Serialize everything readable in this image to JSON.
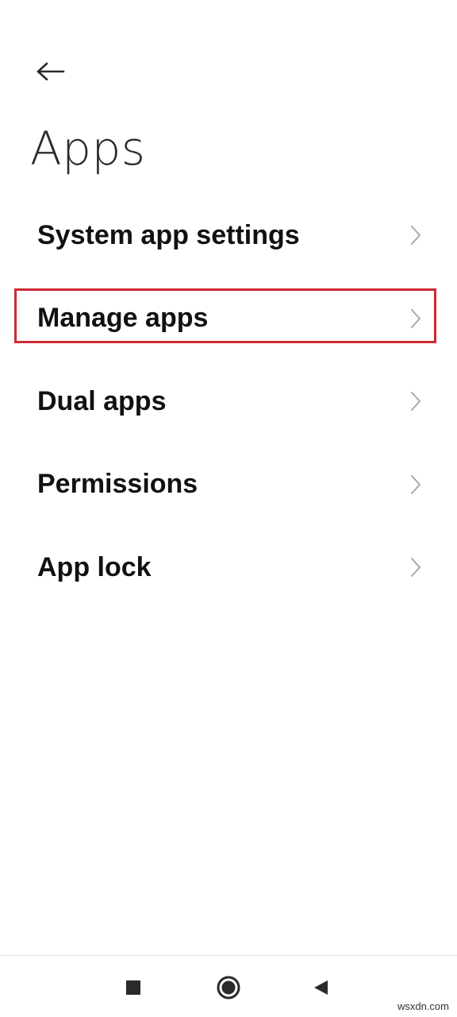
{
  "header": {
    "back_icon": "arrow-left-icon",
    "title": "Apps"
  },
  "menu": {
    "items": [
      {
        "label": "System app settings",
        "icon": "chevron-right-icon",
        "highlighted": false
      },
      {
        "label": "Manage apps",
        "icon": "chevron-right-icon",
        "highlighted": true
      },
      {
        "label": "Dual apps",
        "icon": "chevron-right-icon",
        "highlighted": false
      },
      {
        "label": "Permissions",
        "icon": "chevron-right-icon",
        "highlighted": false
      },
      {
        "label": "App lock",
        "icon": "chevron-right-icon",
        "highlighted": false
      }
    ]
  },
  "highlight": {
    "color": "#cc2a35"
  },
  "navbar": {
    "recent_icon": "square-icon",
    "home_icon": "circle-icon",
    "back_icon": "triangle-left-icon"
  },
  "watermark": {
    "text": "wsxdn.com"
  }
}
